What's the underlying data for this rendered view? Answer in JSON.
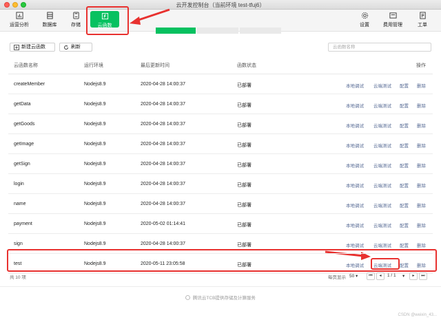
{
  "window": {
    "title": "云开发控制台（当前环境 test-tfuj6）"
  },
  "toolbar": {
    "left_items": [
      {
        "label": "运营分析",
        "icon": "bar-chart-icon"
      },
      {
        "label": "数据库",
        "icon": "database-icon"
      },
      {
        "label": "存储",
        "icon": "storage-icon"
      },
      {
        "label": "云函数",
        "icon": "cloud-function-icon",
        "active": true
      }
    ],
    "right_items": [
      {
        "label": "设置",
        "icon": "gear-icon"
      },
      {
        "label": "费用管理",
        "icon": "billing-icon"
      },
      {
        "label": "工单",
        "icon": "ticket-icon"
      }
    ]
  },
  "actions": {
    "new_function": "新建云函数",
    "refresh": "刷新"
  },
  "search": {
    "placeholder": "云函数名称"
  },
  "table": {
    "headers": {
      "name": "云函数名称",
      "env": "运行环境",
      "updated": "最后更新时间",
      "status": "函数状态",
      "ops": "操作"
    },
    "op_labels": {
      "local_debug": "本地调试",
      "cloud_test": "云端测试",
      "config": "配置",
      "delete": "删除"
    },
    "rows": [
      {
        "name": "createMember",
        "env": "Nodejs8.9",
        "updated": "2020-04-28 14:00:37",
        "status": "已部署"
      },
      {
        "name": "getData",
        "env": "Nodejs8.9",
        "updated": "2020-04-28 14:00:37",
        "status": "已部署"
      },
      {
        "name": "getGoods",
        "env": "Nodejs8.9",
        "updated": "2020-04-28 14:00:37",
        "status": "已部署"
      },
      {
        "name": "getImage",
        "env": "Nodejs8.9",
        "updated": "2020-04-28 14:00:37",
        "status": "已部署"
      },
      {
        "name": "getSign",
        "env": "Nodejs8.9",
        "updated": "2020-04-28 14:00:37",
        "status": "已部署"
      },
      {
        "name": "login",
        "env": "Nodejs8.9",
        "updated": "2020-04-28 14:00:37",
        "status": "已部署"
      },
      {
        "name": "name",
        "env": "Nodejs8.9",
        "updated": "2020-04-28 14:00:37",
        "status": "已部署"
      },
      {
        "name": "payment",
        "env": "Nodejs8.9",
        "updated": "2020-05-02 01:14:41",
        "status": "已部署"
      },
      {
        "name": "sign",
        "env": "Nodejs8.9",
        "updated": "2020-04-28 14:00:37",
        "status": "已部署"
      },
      {
        "name": "test",
        "env": "Nodejs8.9",
        "updated": "2020-05-11 23:05:58",
        "status": "已部署"
      }
    ]
  },
  "footer": {
    "total": "共 10 项",
    "page_size_label": "每页显示",
    "page_size": "50",
    "page_info": "1 / 1"
  },
  "bottom_note": "腾讯云TCB提供存储及计算服务",
  "watermark": "CSDN @weixin_43...",
  "colors": {
    "accent": "#07c160",
    "link": "#576b95",
    "highlight": "#e8312f"
  }
}
